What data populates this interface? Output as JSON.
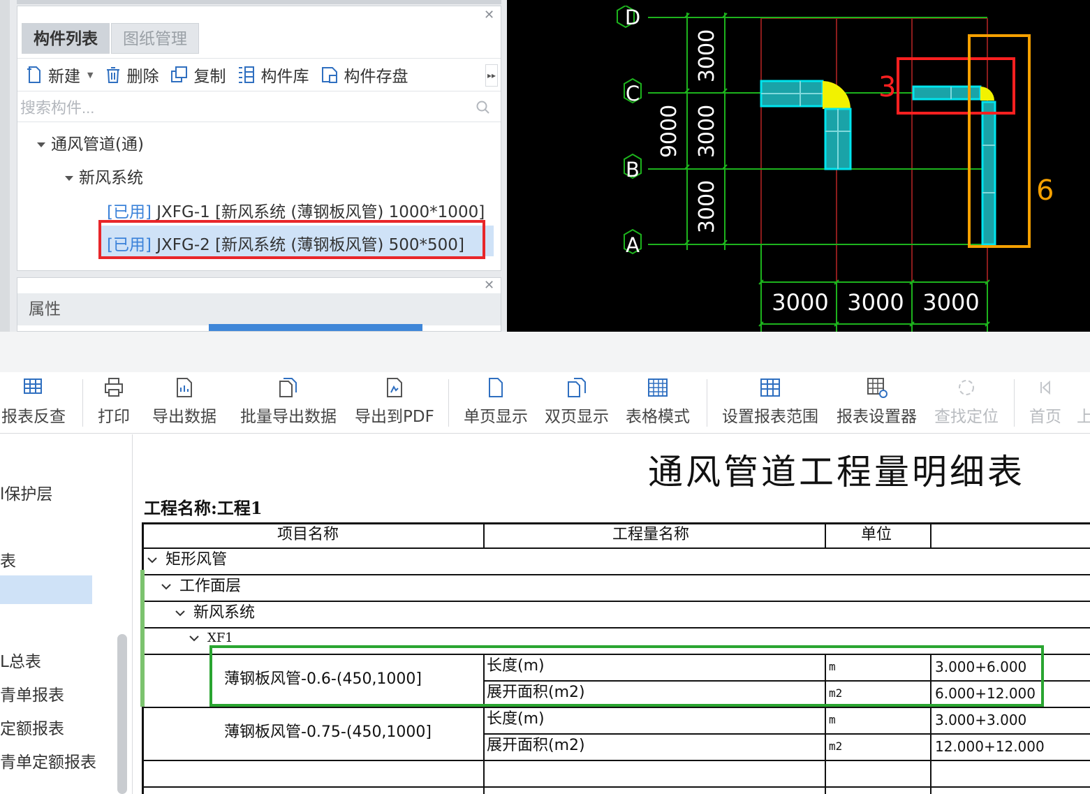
{
  "component_panel": {
    "tabs": [
      "构件列表",
      "图纸管理"
    ],
    "toolbar": {
      "new": "新建",
      "delete": "删除",
      "copy": "复制",
      "library": "构件库",
      "save": "构件存盘"
    },
    "search_placeholder": "搜索构件...",
    "tree": {
      "root": "通风管道(通)",
      "group": "新风系统",
      "items": [
        {
          "tag": "[已用]",
          "text": " JXFG-1 [新风系统 (薄钢板风管) 1000*1000]"
        },
        {
          "tag": "[已用]",
          "text": " JXFG-2 [新风系统 (薄钢板风管) 500*500]"
        }
      ]
    },
    "selected_index": 1
  },
  "properties_panel": {
    "title": "属性"
  },
  "cad": {
    "axes_rows": [
      "D",
      "C",
      "B",
      "A"
    ],
    "dims_vertical": [
      "3000",
      "3000",
      "3000"
    ],
    "dim_total_vertical": "9000",
    "dims_horizontal": [
      "3000",
      "3000",
      "3000"
    ],
    "annotations": {
      "red_label": "3",
      "orange_label": "6"
    },
    "colors": {
      "grid_green": "#1db31d",
      "grid_red": "#8c1c1c",
      "duct": "#00e5ee",
      "elbow": "#f2f200",
      "red": "#ff2020",
      "orange": "#f5a000"
    }
  },
  "report_toolbar": [
    {
      "label": "报表反查",
      "icon": "report-lookup-icon",
      "disabled": false
    },
    {
      "label": "打印",
      "icon": "print-icon",
      "disabled": false
    },
    {
      "label": "导出数据",
      "icon": "export-data-icon",
      "disabled": false
    },
    {
      "label": "批量导出数据",
      "icon": "batch-export-icon",
      "disabled": false
    },
    {
      "label": "导出到PDF",
      "icon": "export-pdf-icon",
      "disabled": false
    },
    {
      "label": "单页显示",
      "icon": "single-page-icon",
      "disabled": false
    },
    {
      "label": "双页显示",
      "icon": "double-page-icon",
      "disabled": false
    },
    {
      "label": "表格模式",
      "icon": "table-mode-icon",
      "disabled": false
    },
    {
      "label": "设置报表范围",
      "icon": "report-range-icon",
      "disabled": false
    },
    {
      "label": "报表设置器",
      "icon": "report-settings-icon",
      "disabled": false
    },
    {
      "label": "查找定位",
      "icon": "find-locate-icon",
      "disabled": true
    },
    {
      "label": "首页",
      "icon": "first-page-icon",
      "disabled": true
    },
    {
      "label": "上",
      "icon": "",
      "disabled": true
    }
  ],
  "left_nav": [
    "l保护层",
    "表",
    "",
    "L总表",
    "青单报表",
    "定额报表",
    "青单定额报表"
  ],
  "report": {
    "title": "通风管道工程量明细表",
    "project": "工程名称:工程1",
    "headers": [
      "项目名称",
      "工程量名称",
      "单位"
    ],
    "groups": [
      "矩形风管",
      "工作面层",
      "新风系统",
      "XF1"
    ],
    "rows": [
      {
        "item": "薄钢板风管-0.6-(450,1000]",
        "qty": [
          {
            "name": "长度(m)",
            "unit": "m",
            "value": "3.000+6.000"
          },
          {
            "name": "展开面积(m2)",
            "unit": "m2",
            "value": "6.000+12.000"
          }
        ]
      },
      {
        "item": "薄钢板风管-0.75-(450,1000]",
        "qty": [
          {
            "name": "长度(m)",
            "unit": "m",
            "value": "3.000+3.000"
          },
          {
            "name": "展开面积(m2)",
            "unit": "m2",
            "value": "12.000+12.000"
          }
        ]
      }
    ]
  }
}
